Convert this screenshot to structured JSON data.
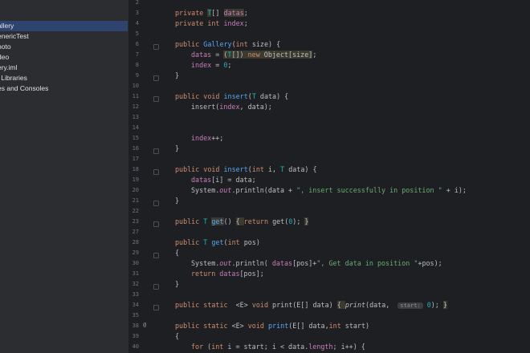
{
  "project_tree": {
    "items": [
      {
        "label": "f",
        "selected": false
      },
      {
        "label": "allery",
        "selected": true
      },
      {
        "label": "enericTest",
        "selected": false
      },
      {
        "label": "hoto",
        "selected": false
      },
      {
        "label": "deo",
        "selected": false
      },
      {
        "label": "ery.iml",
        "selected": false
      },
      {
        "label": "l Libraries",
        "selected": false
      },
      {
        "label": "es and Consoles",
        "selected": false
      }
    ]
  },
  "editor": {
    "line_numbers": [
      "2",
      "3",
      "4",
      "5",
      "6",
      "7",
      "8",
      "9",
      "10",
      "11",
      "12",
      "13",
      "14",
      "15",
      "16",
      "17",
      "18",
      "19",
      "20",
      "21",
      "22",
      "23",
      "27",
      "28",
      "29",
      "30",
      "31",
      "32",
      "33",
      "34",
      "35",
      "38",
      "39",
      "40"
    ],
    "code": {
      "l3": [
        "private ",
        "T",
        "[] ",
        "datas",
        ";"
      ],
      "l4": [
        "private ",
        "int ",
        "index",
        ";"
      ],
      "l6": [
        "public ",
        "Gallery",
        "(",
        "int ",
        "size) {"
      ],
      "l7": [
        "datas",
        " = ",
        "(",
        "T",
        "[]) ",
        "new ",
        "Object[size]",
        ";"
      ],
      "l8": [
        "index",
        " = ",
        "0",
        ";"
      ],
      "l9": "}",
      "l11": [
        "public void ",
        "insert",
        "(",
        "T ",
        "data) {"
      ],
      "l12": [
        "insert(",
        "index",
        ", data);"
      ],
      "l15": [
        "index",
        "++;"
      ],
      "l16": "}",
      "l18": [
        "public void ",
        "insert",
        "(",
        "int ",
        "i, ",
        "T ",
        "data) {"
      ],
      "l19": [
        "datas",
        "[i] = data;"
      ],
      "l20": [
        "System.",
        "out",
        ".println(data + ",
        "\", insert successfully in position \"",
        " + i);"
      ],
      "l21": "}",
      "l23": [
        "public ",
        "T ",
        "get",
        "() ",
        "{ ",
        "return ",
        "get(",
        "0",
        "); ",
        "}"
      ],
      "l28": [
        "public ",
        "T ",
        "get",
        "(",
        "int ",
        "pos)"
      ],
      "l29": "{",
      "l30": [
        "System.",
        "out",
        ".println( ",
        "datas",
        "[pos]+",
        "\", Get data in position \"",
        "+pos);"
      ],
      "l31": [
        "return ",
        "datas",
        "[pos];"
      ],
      "l32": "}",
      "l34": [
        "public static  ",
        "<E> ",
        "void ",
        "print",
        "(E[] data) ",
        "{ ",
        "print",
        "(data,  ",
        "start:",
        " 0",
        "); ",
        "}"
      ],
      "l38": [
        "public static ",
        "<E> ",
        "void ",
        "print",
        "(E[] data,",
        "int ",
        "start)"
      ],
      "l39": "{",
      "l40": [
        "for ",
        "(",
        "int ",
        "i = start; i < data.",
        "length",
        "; i++) {"
      ]
    }
  }
}
